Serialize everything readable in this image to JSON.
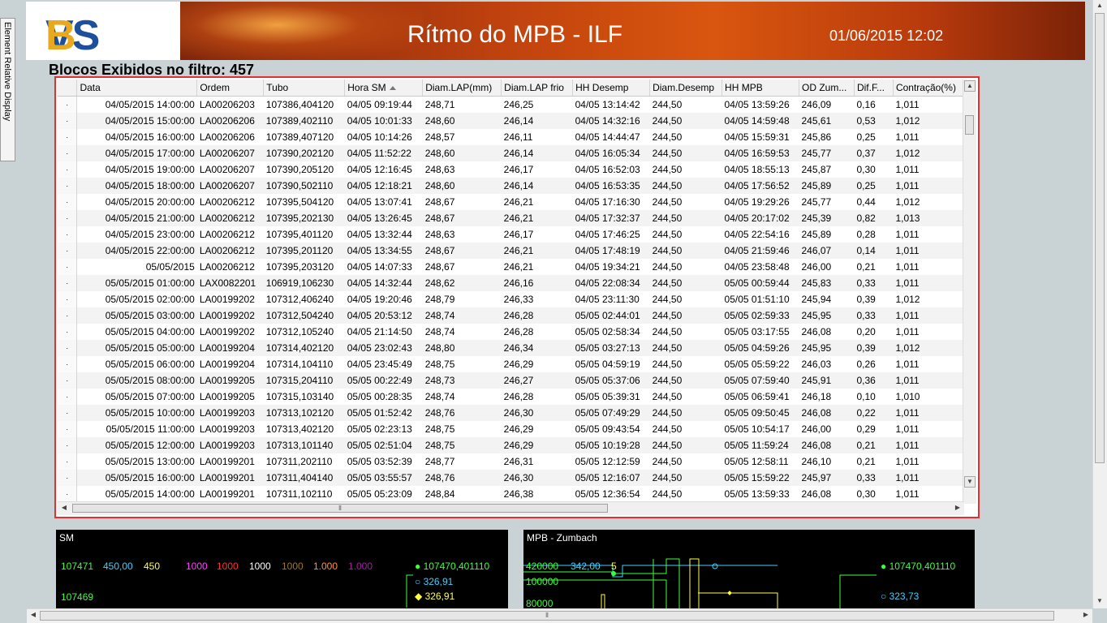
{
  "side_tab": {
    "label": "Element Relative Display"
  },
  "header": {
    "logo_left": "VS",
    "logo_right": "B",
    "title": "Rítmo do MPB - ILF",
    "datetime": "01/06/2015 12:02"
  },
  "filter": {
    "label": "Blocos Exibidos no filtro: 457"
  },
  "table": {
    "columns": [
      "",
      "Data",
      "Ordem",
      "Tubo",
      "Hora SM",
      "Diam.LAP(mm)",
      "Diam.LAP frio",
      "HH Desemp",
      "Diam.Desemp",
      "HH MPB",
      "OD Zum...",
      "Dif.F...",
      "Contração(%)"
    ],
    "sorted_column": "Hora SM",
    "rows": [
      [
        "·",
        "04/05/2015 14:00:00",
        "LA00206203",
        "107386,404120",
        "04/05 09:19:44",
        "248,71",
        "246,25",
        "04/05 13:14:42",
        "244,50",
        "04/05 13:59:26",
        "246,09",
        "0,16",
        "1,011"
      ],
      [
        "·",
        "04/05/2015 15:00:00",
        "LA00206206",
        "107389,402110",
        "04/05 10:01:33",
        "248,60",
        "246,14",
        "04/05 14:32:16",
        "244,50",
        "04/05 14:59:48",
        "245,61",
        "0,53",
        "1,012"
      ],
      [
        "·",
        "04/05/2015 16:00:00",
        "LA00206206",
        "107389,407120",
        "04/05 10:14:26",
        "248,57",
        "246,11",
        "04/05 14:44:47",
        "244,50",
        "04/05 15:59:31",
        "245,86",
        "0,25",
        "1,011"
      ],
      [
        "·",
        "04/05/2015 17:00:00",
        "LA00206207",
        "107390,202120",
        "04/05 11:52:22",
        "248,60",
        "246,14",
        "04/05 16:05:34",
        "244,50",
        "04/05 16:59:53",
        "245,77",
        "0,37",
        "1,012"
      ],
      [
        "·",
        "04/05/2015 19:00:00",
        "LA00206207",
        "107390,205120",
        "04/05 12:16:45",
        "248,63",
        "246,17",
        "04/05 16:52:03",
        "244,50",
        "04/05 18:55:13",
        "245,87",
        "0,30",
        "1,011"
      ],
      [
        "·",
        "04/05/2015 18:00:00",
        "LA00206207",
        "107390,502110",
        "04/05 12:18:21",
        "248,60",
        "246,14",
        "04/05 16:53:35",
        "244,50",
        "04/05 17:56:52",
        "245,89",
        "0,25",
        "1,011"
      ],
      [
        "·",
        "04/05/2015 20:00:00",
        "LA00206212",
        "107395,504120",
        "04/05 13:07:41",
        "248,67",
        "246,21",
        "04/05 17:16:30",
        "244,50",
        "04/05 19:29:26",
        "245,77",
        "0,44",
        "1,012"
      ],
      [
        "·",
        "04/05/2015 21:00:00",
        "LA00206212",
        "107395,202130",
        "04/05 13:26:45",
        "248,67",
        "246,21",
        "04/05 17:32:37",
        "244,50",
        "04/05 20:17:02",
        "245,39",
        "0,82",
        "1,013"
      ],
      [
        "·",
        "04/05/2015 23:00:00",
        "LA00206212",
        "107395,401120",
        "04/05 13:32:44",
        "248,63",
        "246,17",
        "04/05 17:46:25",
        "244,50",
        "04/05 22:54:16",
        "245,89",
        "0,28",
        "1,011"
      ],
      [
        "·",
        "04/05/2015 22:00:00",
        "LA00206212",
        "107395,201120",
        "04/05 13:34:55",
        "248,67",
        "246,21",
        "04/05 17:48:19",
        "244,50",
        "04/05 21:59:46",
        "246,07",
        "0,14",
        "1,011"
      ],
      [
        "·",
        "05/05/2015",
        "LA00206212",
        "107395,203120",
        "04/05 14:07:33",
        "248,67",
        "246,21",
        "04/05 19:34:21",
        "244,50",
        "04/05 23:58:48",
        "246,00",
        "0,21",
        "1,011"
      ],
      [
        "·",
        "05/05/2015 01:00:00",
        "LAX0082201",
        "106919,106230",
        "04/05 14:32:44",
        "248,62",
        "246,16",
        "04/05 22:08:34",
        "244,50",
        "05/05 00:59:44",
        "245,83",
        "0,33",
        "1,011"
      ],
      [
        "·",
        "05/05/2015 02:00:00",
        "LA00199202",
        "107312,406240",
        "04/05 19:20:46",
        "248,79",
        "246,33",
        "04/05 23:11:30",
        "244,50",
        "05/05 01:51:10",
        "245,94",
        "0,39",
        "1,012"
      ],
      [
        "·",
        "05/05/2015 03:00:00",
        "LA00199202",
        "107312,504240",
        "04/05 20:53:12",
        "248,74",
        "246,28",
        "05/05 02:44:01",
        "244,50",
        "05/05 02:59:33",
        "245,95",
        "0,33",
        "1,011"
      ],
      [
        "·",
        "05/05/2015 04:00:00",
        "LA00199202",
        "107312,105240",
        "04/05 21:14:50",
        "248,74",
        "246,28",
        "05/05 02:58:34",
        "244,50",
        "05/05 03:17:55",
        "246,08",
        "0,20",
        "1,011"
      ],
      [
        "·",
        "05/05/2015 05:00:00",
        "LA00199204",
        "107314,402120",
        "04/05 23:02:43",
        "248,80",
        "246,34",
        "05/05 03:27:13",
        "244,50",
        "05/05 04:59:26",
        "245,95",
        "0,39",
        "1,012"
      ],
      [
        "·",
        "05/05/2015 06:00:00",
        "LA00199204",
        "107314,104110",
        "04/05 23:45:49",
        "248,75",
        "246,29",
        "05/05 04:59:19",
        "244,50",
        "05/05 05:59:22",
        "246,03",
        "0,26",
        "1,011"
      ],
      [
        "·",
        "05/05/2015 08:00:00",
        "LA00199205",
        "107315,204110",
        "05/05 00:22:49",
        "248,73",
        "246,27",
        "05/05 05:37:06",
        "244,50",
        "05/05 07:59:40",
        "245,91",
        "0,36",
        "1,011"
      ],
      [
        "·",
        "05/05/2015 07:00:00",
        "LA00199205",
        "107315,103140",
        "05/05 00:28:35",
        "248,74",
        "246,28",
        "05/05 05:39:31",
        "244,50",
        "05/05 06:59:41",
        "246,18",
        "0,10",
        "1,010"
      ],
      [
        "·",
        "05/05/2015 10:00:00",
        "LA00199203",
        "107313,102120",
        "05/05 01:52:42",
        "248,76",
        "246,30",
        "05/05 07:49:29",
        "244,50",
        "05/05 09:50:45",
        "246,08",
        "0,22",
        "1,011"
      ],
      [
        "·",
        "05/05/2015 11:00:00",
        "LA00199203",
        "107313,402120",
        "05/05 02:23:13",
        "248,75",
        "246,29",
        "05/05 09:43:54",
        "244,50",
        "05/05 10:54:17",
        "246,00",
        "0,29",
        "1,011"
      ],
      [
        "·",
        "05/05/2015 12:00:00",
        "LA00199203",
        "107313,101140",
        "05/05 02:51:04",
        "248,75",
        "246,29",
        "05/05 10:19:28",
        "244,50",
        "05/05 11:59:24",
        "246,08",
        "0,21",
        "1,011"
      ],
      [
        "·",
        "05/05/2015 13:00:00",
        "LA00199201",
        "107311,202110",
        "05/05 03:52:39",
        "248,77",
        "246,31",
        "05/05 12:12:59",
        "244,50",
        "05/05 12:58:11",
        "246,10",
        "0,21",
        "1,011"
      ],
      [
        "·",
        "05/05/2015 16:00:00",
        "LA00199201",
        "107311,404140",
        "05/05 03:55:57",
        "248,76",
        "246,30",
        "05/05 12:16:07",
        "244,50",
        "05/05 15:59:22",
        "245,97",
        "0,33",
        "1,011"
      ],
      [
        "·",
        "05/05/2015 14:00:00",
        "LA00199201",
        "107311,102110",
        "05/05 05:23:09",
        "248,84",
        "246,38",
        "05/05 12:36:54",
        "244,50",
        "05/05 13:59:33",
        "246,08",
        "0,30",
        "1,011"
      ]
    ]
  },
  "panel_sm": {
    "title": "SM",
    "values": [
      {
        "text": "107471",
        "color": "#3cff3c"
      },
      {
        "text": "450,00",
        "color": "#40d0ff"
      },
      {
        "text": "450",
        "color": "#ffff40"
      },
      {
        "text": "1000",
        "color": "#ff40ff"
      },
      {
        "text": "1000",
        "color": "#ff3030"
      },
      {
        "text": "1000",
        "color": "#ffffff"
      },
      {
        "text": "1000",
        "color": "#a07820"
      },
      {
        "text": "1.000",
        "color": "#ff9040"
      },
      {
        "text": "1.000",
        "color": "#a020a0"
      }
    ],
    "bottom_left": "107469",
    "right_values": [
      {
        "text": "● 107470,401110",
        "color": "#3cff3c"
      },
      {
        "text": "○ 326,91",
        "color": "#40d0ff"
      },
      {
        "text": "◆ 326,91",
        "color": "#ffff40"
      }
    ]
  },
  "panel_mpb": {
    "title": "MPB - Zumbach",
    "left_values": [
      {
        "text": "420000",
        "color": "#3cff3c"
      },
      {
        "text": "342,00",
        "color": "#40d0ff"
      },
      {
        "text": "5",
        "color": "#ffff40"
      },
      {
        "text": "100000",
        "color": "#3cff3c"
      },
      {
        "text": "80000",
        "color": "#3cff3c"
      }
    ],
    "right_values": [
      {
        "text": "● 107470,401110",
        "color": "#3cff3c"
      },
      {
        "text": "○ 323,73",
        "color": "#40d0ff"
      }
    ]
  }
}
